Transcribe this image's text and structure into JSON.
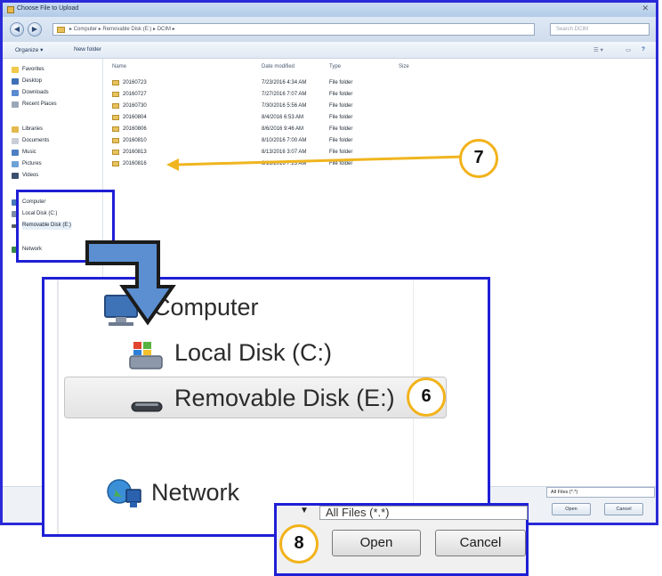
{
  "window": {
    "title": "Choose File to Upload",
    "close_glyph": "✕"
  },
  "address": {
    "path": "▸ Computer ▸ Removable Disk (E:) ▸ DCIM ▸",
    "search_placeholder": "Search DCIM"
  },
  "toolbar": {
    "organize": "Organize ▾",
    "new_folder": "New folder"
  },
  "sidebar": {
    "favorites": "Favorites",
    "desktop": "Desktop",
    "downloads": "Downloads",
    "recent": "Recent Places",
    "libraries": "Libraries",
    "documents": "Documents",
    "music": "Music",
    "pictures": "Pictures",
    "videos": "Videos",
    "computer": "Computer",
    "local_disk": "Local Disk (C:)",
    "removable": "Removable Disk (E:)",
    "network": "Network"
  },
  "columns": {
    "name": "Name",
    "date": "Date modified",
    "type": "Type",
    "size": "Size"
  },
  "files": [
    {
      "name": "20160723",
      "date": "7/23/2016 4:34 AM",
      "type": "File folder"
    },
    {
      "name": "20160727",
      "date": "7/27/2016 7:07 AM",
      "type": "File folder"
    },
    {
      "name": "20160730",
      "date": "7/30/2016 5:56 AM",
      "type": "File folder"
    },
    {
      "name": "20160804",
      "date": "8/4/2016 6:53 AM",
      "type": "File folder"
    },
    {
      "name": "20160806",
      "date": "8/6/2016 9:46 AM",
      "type": "File folder"
    },
    {
      "name": "20160810",
      "date": "8/10/2016 7:00 AM",
      "type": "File folder"
    },
    {
      "name": "20160813",
      "date": "8/13/2016 3:07 AM",
      "type": "File folder"
    },
    {
      "name": "20160816",
      "date": "8/16/2016 7:23 AM",
      "type": "File folder"
    }
  ],
  "bottom": {
    "filter": "All Files (*.*)",
    "open": "Open",
    "cancel": "Cancel"
  },
  "zoom_nav": {
    "computer": "Computer",
    "local_disk": "Local Disk (C:)",
    "removable": "Removable Disk (E:)",
    "network": "Network"
  },
  "zoom_buttons": {
    "filter": "All Files (*.*)",
    "open": "Open",
    "cancel": "Cancel"
  },
  "badges": {
    "step6": "6",
    "step7": "7",
    "step8": "8"
  },
  "colors": {
    "highlight_box": "#1f1fd6",
    "badge_ring": "#f2b21a",
    "callout_arrow": "#f0b51e",
    "bent_arrow": "#5b8fd1"
  }
}
